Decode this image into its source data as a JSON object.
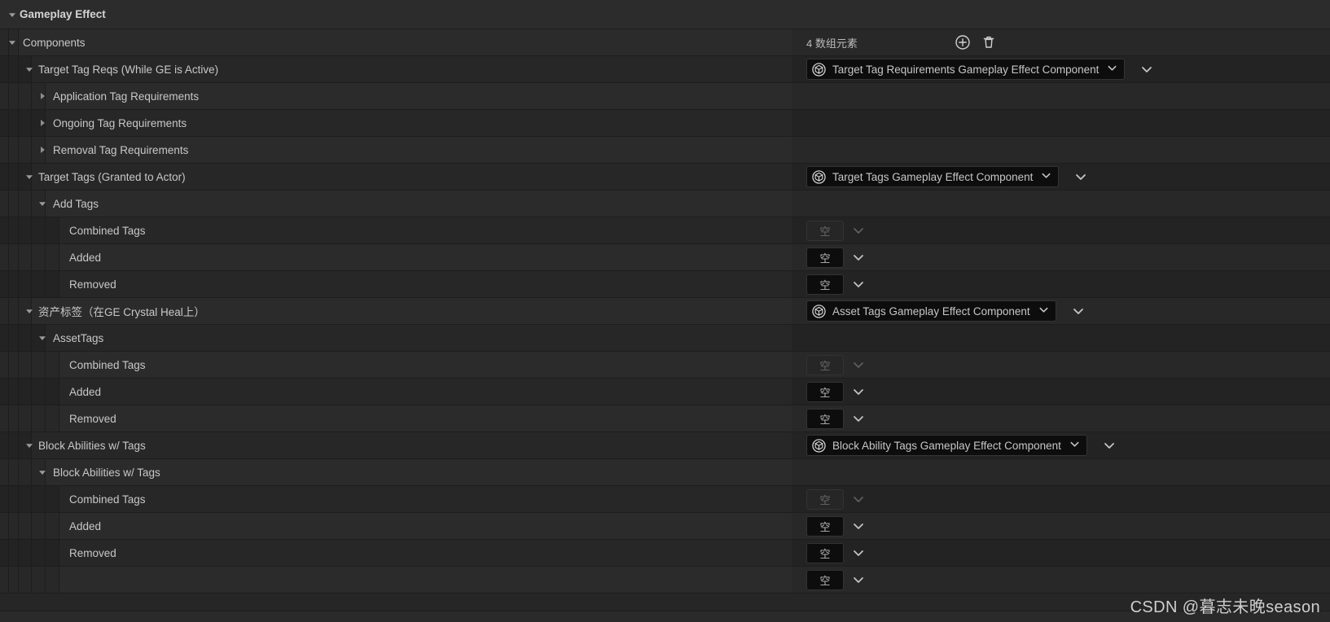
{
  "window": {
    "title": "Gameplay Effect"
  },
  "colors": {
    "panel_bg": "#262626",
    "row_dark": "#282828",
    "row_darker": "#232323",
    "row_header": "#2c2c2c",
    "divider": "#1d1d1d",
    "text": "#c8c8c8",
    "combo_bg": "#0d0d0d",
    "watermark": "#cfcfcf"
  },
  "array": {
    "count_label": "4 数组元素",
    "add_icon": "plus-circle-icon",
    "delete_icon": "trash-icon"
  },
  "empty_value": "空",
  "watermark": "CSDN @暮志未晚season",
  "rows": [
    {
      "id": "gameplay-effect",
      "label": "Gameplay Effect",
      "indent": 0,
      "arrow": "down",
      "bold": true,
      "bg": "head",
      "value": "none"
    },
    {
      "id": "components",
      "label": "Components",
      "indent": 1,
      "arrow": "down",
      "bold": false,
      "bg": "dark",
      "value": "array"
    },
    {
      "id": "target-tag-reqs",
      "label": "Target Tag Reqs (While GE is Active)",
      "indent": 2,
      "arrow": "down",
      "bold": false,
      "bg": "darker",
      "value": "combo",
      "combo": "Target Tag Requirements Gameplay Effect Component"
    },
    {
      "id": "application-tag-reqs",
      "label": "Application Tag Requirements",
      "indent": 3,
      "arrow": "right",
      "bold": false,
      "bg": "dark",
      "value": "none"
    },
    {
      "id": "ongoing-tag-reqs",
      "label": "Ongoing Tag Requirements",
      "indent": 3,
      "arrow": "right",
      "bold": false,
      "bg": "darker",
      "value": "none"
    },
    {
      "id": "removal-tag-reqs",
      "label": "Removal Tag Requirements",
      "indent": 3,
      "arrow": "right",
      "bold": false,
      "bg": "dark",
      "value": "none"
    },
    {
      "id": "target-tags-granted",
      "label": "Target Tags (Granted to Actor)",
      "indent": 2,
      "arrow": "down",
      "bold": false,
      "bg": "darker",
      "value": "combo",
      "combo": "Target Tags Gameplay Effect Component"
    },
    {
      "id": "add-tags",
      "label": "Add Tags",
      "indent": 3,
      "arrow": "down",
      "bold": false,
      "bg": "dark",
      "value": "none"
    },
    {
      "id": "add-tags-combined",
      "label": "Combined Tags",
      "indent": 4,
      "arrow": "none",
      "bold": false,
      "bg": "darker",
      "value": "empty-dim"
    },
    {
      "id": "add-tags-added",
      "label": "Added",
      "indent": 4,
      "arrow": "none",
      "bold": false,
      "bg": "dark",
      "value": "empty"
    },
    {
      "id": "add-tags-removed",
      "label": "Removed",
      "indent": 4,
      "arrow": "none",
      "bold": false,
      "bg": "darker",
      "value": "empty"
    },
    {
      "id": "asset-tags-cn",
      "label": "资产标签（在GE Crystal Heal上）",
      "indent": 2,
      "arrow": "down",
      "bold": false,
      "bg": "dark",
      "value": "combo",
      "combo": "Asset Tags Gameplay Effect Component"
    },
    {
      "id": "assettags",
      "label": "AssetTags",
      "indent": 3,
      "arrow": "down",
      "bold": false,
      "bg": "darker",
      "value": "none"
    },
    {
      "id": "assettags-combined",
      "label": "Combined Tags",
      "indent": 4,
      "arrow": "none",
      "bold": false,
      "bg": "dark",
      "value": "empty-dim"
    },
    {
      "id": "assettags-added",
      "label": "Added",
      "indent": 4,
      "arrow": "none",
      "bold": false,
      "bg": "darker",
      "value": "empty"
    },
    {
      "id": "assettags-removed",
      "label": "Removed",
      "indent": 4,
      "arrow": "none",
      "bold": false,
      "bg": "dark",
      "value": "empty"
    },
    {
      "id": "block-abilities",
      "label": "Block Abilities w/ Tags",
      "indent": 2,
      "arrow": "down",
      "bold": false,
      "bg": "darker",
      "value": "combo",
      "combo": "Block Ability Tags Gameplay Effect Component"
    },
    {
      "id": "block-abilities-inner",
      "label": "Block Abilities w/ Tags",
      "indent": 3,
      "arrow": "down",
      "bold": false,
      "bg": "dark",
      "value": "none"
    },
    {
      "id": "block-combined",
      "label": "Combined Tags",
      "indent": 4,
      "arrow": "none",
      "bold": false,
      "bg": "darker",
      "value": "empty-dim"
    },
    {
      "id": "block-added",
      "label": "Added",
      "indent": 4,
      "arrow": "none",
      "bold": false,
      "bg": "dark",
      "value": "empty"
    },
    {
      "id": "block-removed",
      "label": "Removed",
      "indent": 4,
      "arrow": "none",
      "bold": false,
      "bg": "darker",
      "value": "empty"
    },
    {
      "id": "trailing-row",
      "label": "",
      "indent": 4,
      "arrow": "none",
      "bold": false,
      "bg": "dark",
      "value": "empty"
    }
  ]
}
